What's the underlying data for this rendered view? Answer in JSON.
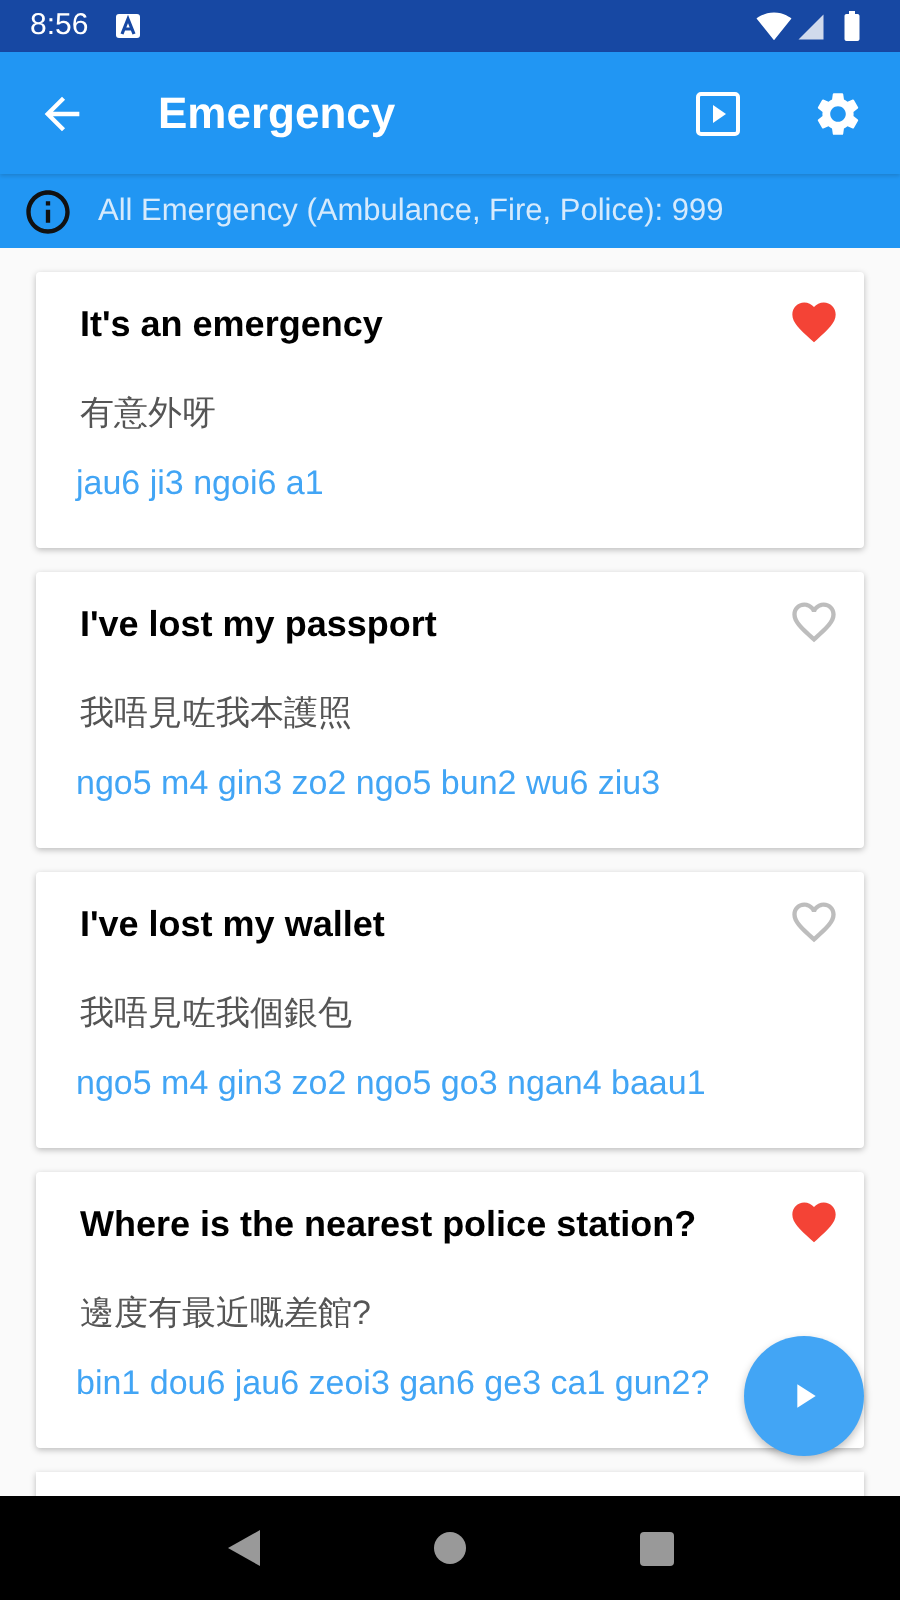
{
  "status_bar": {
    "time": "8:56"
  },
  "app_bar": {
    "title": "Emergency"
  },
  "info": {
    "text": "All Emergency (Ambulance, Fire, Police): 999"
  },
  "phrases": [
    {
      "english": "It's an emergency",
      "chinese": "有意外呀",
      "jyutping": "jau6 ji3 ngoi6 a1",
      "favorite": true
    },
    {
      "english": "I've lost my passport",
      "chinese": "我唔見咗我本護照",
      "jyutping": "ngo5 m4 gin3 zo2 ngo5 bun2 wu6 ziu3",
      "favorite": false
    },
    {
      "english": "I've lost my wallet",
      "chinese": "我唔見咗我個銀包",
      "jyutping": "ngo5 m4 gin3 zo2 ngo5 go3 ngan4 baau1",
      "favorite": false
    },
    {
      "english": "Where is the nearest police station?",
      "chinese": "邊度有最近嘅差館?",
      "jyutping": "bin1 dou6 jau6 zeoi3 gan6 ge3 ca1 gun2?",
      "favorite": true
    }
  ]
}
